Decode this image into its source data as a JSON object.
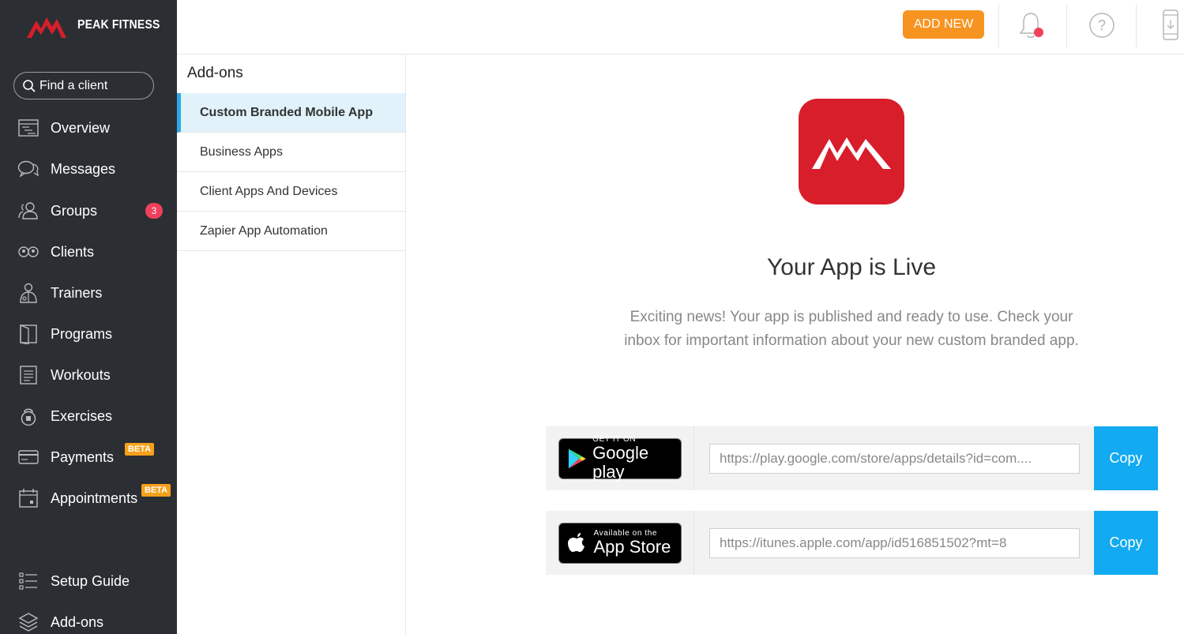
{
  "brand": {
    "name": "PEAK FITNESS",
    "accent": "#d81e2b"
  },
  "search": {
    "label": "Find a client"
  },
  "sidebar": {
    "items": [
      {
        "label": "Overview",
        "icon": "overview-icon"
      },
      {
        "label": "Messages",
        "icon": "messages-icon"
      },
      {
        "label": "Groups",
        "icon": "groups-icon",
        "count": "3"
      },
      {
        "label": "Clients",
        "icon": "clients-icon"
      },
      {
        "label": "Trainers",
        "icon": "trainers-icon"
      },
      {
        "label": "Programs",
        "icon": "programs-icon"
      },
      {
        "label": "Workouts",
        "icon": "workouts-icon"
      },
      {
        "label": "Exercises",
        "icon": "exercises-icon"
      },
      {
        "label": "Payments",
        "icon": "payments-icon",
        "badge": "BETA"
      },
      {
        "label": "Appointments",
        "icon": "appointments-icon",
        "badge": "BETA"
      },
      {
        "label": "Setup Guide",
        "icon": "setup-guide-icon"
      },
      {
        "label": "Add-ons",
        "icon": "add-ons-icon"
      }
    ]
  },
  "topbar": {
    "add_new_label": "ADD NEW",
    "add_new_color": "#f79421",
    "icons": [
      "bell-icon",
      "help-icon",
      "mobile-download-icon"
    ]
  },
  "addons": {
    "title": "Add-ons",
    "items": [
      {
        "label": "Custom Branded Mobile App",
        "active": true
      },
      {
        "label": "Business Apps"
      },
      {
        "label": "Client Apps And Devices"
      },
      {
        "label": "Zapier App Automation"
      }
    ]
  },
  "main": {
    "headline": "Your App is Live",
    "description": "Exciting news! Your app is published and ready to use. Check your inbox for important information about your new custom branded app.",
    "stores": [
      {
        "badge_small": "GET IT ON",
        "badge_big": "Google play",
        "url": "https://play.google.com/store/apps/details?id=com....",
        "copy_label": "Copy"
      },
      {
        "badge_small": "Available on the",
        "badge_big": "App Store",
        "url": "https://itunes.apple.com/app/id516851502?mt=8",
        "copy_label": "Copy"
      }
    ],
    "copy_color": "#12aaf0"
  }
}
